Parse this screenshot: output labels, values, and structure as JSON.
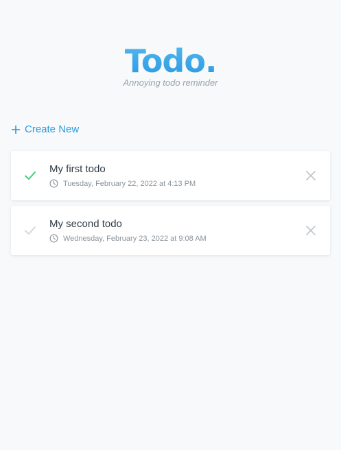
{
  "header": {
    "title": "Todo.",
    "subtitle": "Annoying todo reminder"
  },
  "actions": {
    "create_new_label": "Create New"
  },
  "todos": [
    {
      "title": "My first todo",
      "datetime": "Tuesday, February 22, 2022 at 4:13 PM",
      "done": true
    },
    {
      "title": "My second todo",
      "datetime": "Wednesday, February 23, 2022 at 9:08 AM",
      "done": false
    }
  ],
  "colors": {
    "accent": "#2d9cdb",
    "check_done": "#3ccf7a",
    "check_pending": "#d3d8dd",
    "close_icon": "#c2c8ce",
    "background": "#f7f9fb"
  },
  "icons": {
    "create": "plus-icon",
    "done": "check-icon",
    "time": "clock-icon",
    "delete": "close-icon"
  }
}
